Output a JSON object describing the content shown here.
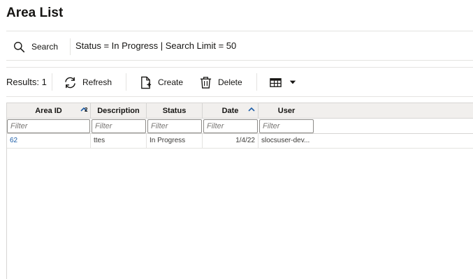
{
  "page": {
    "title": "Area List"
  },
  "search": {
    "button_label": "Search",
    "criteria": "Status = In Progress | Search Limit = 50"
  },
  "toolbar": {
    "results": "Results: 1",
    "refresh_label": "Refresh",
    "create_label": "Create",
    "delete_label": "Delete"
  },
  "grid": {
    "columns": [
      {
        "label": "Area ID",
        "sort": "descending",
        "sort_order": "2"
      },
      {
        "label": "Description"
      },
      {
        "label": "Status"
      },
      {
        "label": "Date",
        "sort": "descending"
      },
      {
        "label": "User"
      }
    ],
    "filter_placeholder": "Filter",
    "rows": [
      {
        "area_id": "62",
        "description": "ttes",
        "status": "In Progress",
        "date": "1/4/22",
        "user": "slocsuser-dev..."
      }
    ]
  },
  "colors": {
    "link": "#1f5fa8",
    "header_bg": "#f1efed",
    "sort_icon": "#1f5fa8"
  }
}
